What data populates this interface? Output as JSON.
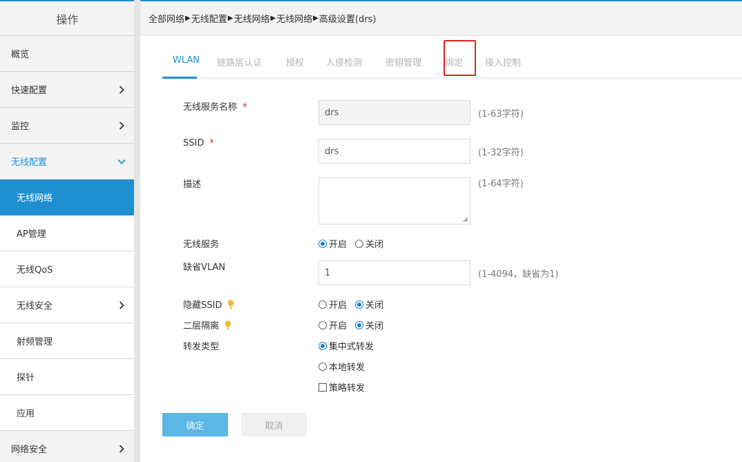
{
  "sidebar": {
    "header": "操作",
    "items": [
      {
        "label": "概览"
      },
      {
        "label": "快速配置"
      },
      {
        "label": "监控"
      },
      {
        "label": "无线配置"
      },
      {
        "label": "无线网络"
      },
      {
        "label": "AP管理"
      },
      {
        "label": "无线QoS"
      },
      {
        "label": "无线安全"
      },
      {
        "label": "射频管理"
      },
      {
        "label": "探针"
      },
      {
        "label": "应用"
      },
      {
        "label": "网络安全"
      }
    ]
  },
  "breadcrumb": [
    "全部网络",
    "无线配置",
    "无线网络",
    "无线网络",
    "高级设置(drs)"
  ],
  "tabs": [
    "WLAN",
    "链路层认证",
    "授权",
    "入侵检测",
    "密钥管理",
    "绑定",
    "接入控制"
  ],
  "form": {
    "service_name": {
      "label": "无线服务名称",
      "value": "drs",
      "hint": "(1-63字符)"
    },
    "ssid": {
      "label": "SSID",
      "value": "drs",
      "hint": "(1-32字符)"
    },
    "description": {
      "label": "描述",
      "value": "",
      "hint": "(1-64字符)"
    },
    "wireless_service": {
      "label": "无线服务",
      "options": [
        "开启",
        "关闭"
      ],
      "selected": "开启"
    },
    "default_vlan": {
      "label": "缺省VLAN",
      "value": "1",
      "hint": "(1-4094，缺省为1)"
    },
    "hide_ssid": {
      "label": "隐藏SSID",
      "options": [
        "开启",
        "关闭"
      ],
      "selected": "关闭"
    },
    "l2_isolation": {
      "label": "二层隔离",
      "options": [
        "开启",
        "关闭"
      ],
      "selected": "关闭"
    },
    "forward_type": {
      "label": "转发类型",
      "options": [
        "集中式转发",
        "本地转发"
      ],
      "selected": "集中式转发",
      "policy_label": "策略转发",
      "policy_checked": false
    }
  },
  "buttons": {
    "ok": "确定",
    "cancel": "取消"
  },
  "colors": {
    "accent": "#1e90d0",
    "required": "#e02020",
    "highlight_box": "#e02020",
    "bulb": "#f5b82e"
  }
}
